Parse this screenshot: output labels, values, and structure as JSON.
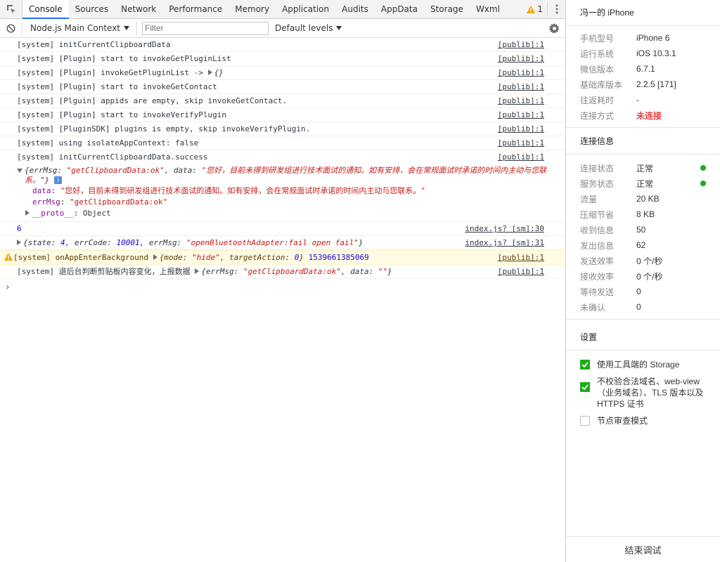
{
  "tabs": [
    "Console",
    "Sources",
    "Network",
    "Performance",
    "Memory",
    "Application",
    "Audits",
    "AppData",
    "Storage",
    "Wxml"
  ],
  "warning_count": "1",
  "toolbar": {
    "context": "Node.js Main Context",
    "filter_placeholder": "Filter",
    "levels": "Default levels"
  },
  "console": {
    "lines": [
      {
        "text": "[system] initCurrentClipboardData",
        "src": "[publib]:1"
      },
      {
        "text": "[system] [Plugin] start to invokeGetPluginList",
        "src": "[publib]:1"
      },
      {
        "text": "[system] [Plugin] invokeGetPluginList -> ",
        "obj": "{}",
        "src": "[publib]:1"
      },
      {
        "text": "[system] [Plugin] start to invokeGetContact",
        "src": "[publib]:1"
      },
      {
        "text": "[system] [Plguin] appids are empty, skip invokeGetContact.",
        "src": "[publib]:1"
      },
      {
        "text": "[system] [Plugin] start to invokeVerifyPlugin",
        "src": "[publib]:1"
      },
      {
        "text": "[system] [PluginSDK] plugins is empty, skip invokeVerifyPlugin.",
        "src": "[publib]:1"
      },
      {
        "text": "[system] using isolateAppContext: false",
        "src": "[publib]:1"
      },
      {
        "text": "[system] initCurrentClipboardData.success",
        "src": "[publib]:1"
      }
    ],
    "expanded": {
      "head_prefix": "{errMsg: ",
      "head_errmsg": "\"getClipboardData:ok\"",
      "head_mid": ", data: ",
      "head_data": "\"您好，目前未得到研发组进行技术面试的通知。如有安排，会在常规面试时承诺的时间内主动与您联系。\"",
      "head_suffix": "}",
      "info_badge": "i",
      "prop1_key": "data",
      "prop1_val": "\"您好，目前未得到研发组进行技术面试的通知。如有安排，会在常规面试时承诺的时间内主动与您联系。\"",
      "prop2_key": "errMsg",
      "prop2_val": "\"getClipboardData:ok\"",
      "proto_key": "__proto__",
      "proto_val": "Object"
    },
    "num_line": {
      "value": "6",
      "src": "index.js? [sm]:30"
    },
    "state_line": {
      "p1": "{state: ",
      "state": "4",
      "p2": ", errCode: ",
      "code": "10001",
      "p3": ", errMsg: ",
      "msg": "\"openBluetoothAdapter:fail open fail\"",
      "p4": "}",
      "src": "index.js? [sm]:31"
    },
    "warn_line": {
      "text": "[system] onAppEnterBackground ",
      "p1": "{mode: ",
      "mode": "\"hide\"",
      "p2": ", targetAction: ",
      "action": "0",
      "p3": "}",
      "ts": "1539661385069",
      "src": "[publib]:1"
    },
    "last_line": {
      "text": "[system] 退后台判断剪贴板内容变化，上报数据 ",
      "p1": "{errMsg: ",
      "errmsg": "\"getClipboardData:ok\"",
      "p2": ", data: ",
      "data": "\"\"",
      "p3": "}",
      "src": "[publib]:1"
    },
    "prompt": "›"
  },
  "panel": {
    "title": "冯一的 iPhone",
    "device": [
      {
        "k": "手机型号",
        "v": "iPhone 6"
      },
      {
        "k": "运行系统",
        "v": "iOS 10.3.1"
      },
      {
        "k": "微信版本",
        "v": "6.7.1"
      },
      {
        "k": "基础库版本",
        "v": "2.2.5 [171]"
      },
      {
        "k": "往返耗时",
        "v": "-"
      },
      {
        "k": "连接方式",
        "v": "未连接"
      }
    ],
    "conn_title": "连接信息",
    "conn": [
      {
        "k": "连接状态",
        "v": "正常"
      },
      {
        "k": "服务状态",
        "v": "正常"
      },
      {
        "k": "流量",
        "v": "20 KB"
      },
      {
        "k": "压缩节省",
        "v": "8 KB"
      },
      {
        "k": "收到信息",
        "v": "50"
      },
      {
        "k": "发出信息",
        "v": "62"
      },
      {
        "k": "发送效率",
        "v": "0 个/秒"
      },
      {
        "k": "接收效率",
        "v": "0 个/秒"
      },
      {
        "k": "等待发送",
        "v": "0"
      },
      {
        "k": "未确认",
        "v": "0"
      }
    ],
    "settings_title": "设置",
    "settings": [
      {
        "label": "使用工具端的 Storage",
        "checked": true
      },
      {
        "label": "不校验合法域名、web-view（业务域名）、TLS 版本以及 HTTPS 证书",
        "checked": true
      },
      {
        "label": "节点审查模式",
        "checked": false
      }
    ],
    "end_button": "结束调试",
    "colors": {
      "accent": "#1aad19",
      "danger": "#e64340",
      "link": "#1a73e8"
    }
  }
}
